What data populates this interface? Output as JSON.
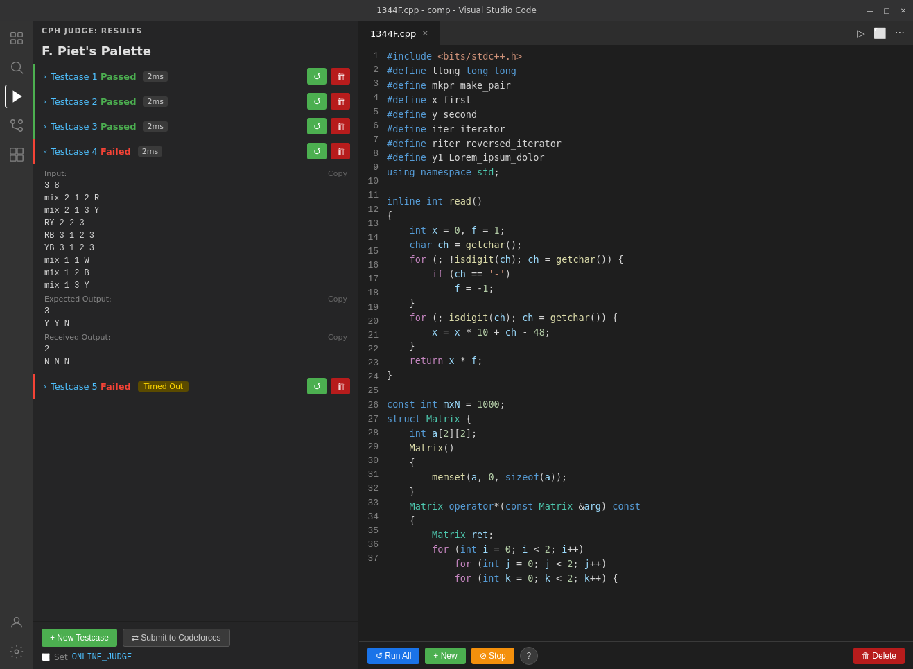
{
  "titlebar": {
    "title": "1344F.cpp - comp - Visual Studio Code",
    "min": "—",
    "max": "□",
    "close": "✕"
  },
  "activity": {
    "icons": [
      "explorer",
      "search",
      "source-control",
      "run",
      "extensions",
      "settings"
    ]
  },
  "cph": {
    "header": "CPH JUDGE: RESULTS",
    "problem_title": "F. Piet's Palette",
    "testcases": [
      {
        "id": 1,
        "status": "Passed",
        "time": "2ms",
        "expanded": false,
        "color": "passed"
      },
      {
        "id": 2,
        "status": "Passed",
        "time": "2ms",
        "expanded": false,
        "color": "passed"
      },
      {
        "id": 3,
        "status": "Passed",
        "time": "2ms",
        "expanded": false,
        "color": "passed"
      },
      {
        "id": 4,
        "status": "Failed",
        "time": "2ms",
        "expanded": true,
        "color": "failed",
        "input": "3 8\nmix 2 1 2 R\nmix 2 1 3 Y\nRY 2 2 3\nRB 3 1 2 3\nYB 3 1 2 3\nmix 1 1 W\nmix 1 2 B\nmix 1 3 Y",
        "expected_output": "3\nY Y N",
        "received_output": "2\nN N N"
      },
      {
        "id": 5,
        "status": "Failed",
        "time_badge": "Timed Out",
        "expanded": false,
        "color": "failed"
      }
    ],
    "new_testcase_label": "+ New Testcase",
    "submit_label": "⇄ Submit to Codeforces",
    "online_judge_label": "ONLINE_JUDGE",
    "set_label": "Set"
  },
  "editor": {
    "tab_name": "1344F.cpp",
    "lines": [
      {
        "n": 1,
        "code": "#include <bits/stdc++.h>"
      },
      {
        "n": 2,
        "code": "#define llong long long"
      },
      {
        "n": 3,
        "code": "#define mkpr make_pair"
      },
      {
        "n": 4,
        "code": "#define x first"
      },
      {
        "n": 5,
        "code": "#define y second"
      },
      {
        "n": 6,
        "code": "#define iter iterator"
      },
      {
        "n": 7,
        "code": "#define riter reversed_iterator"
      },
      {
        "n": 8,
        "code": "#define y1 Lorem_ipsum_dolor"
      },
      {
        "n": 9,
        "code": "using namespace std;"
      },
      {
        "n": 10,
        "code": ""
      },
      {
        "n": 11,
        "code": "inline int read()"
      },
      {
        "n": 12,
        "code": "{"
      },
      {
        "n": 13,
        "code": "    int x = 0, f = 1;"
      },
      {
        "n": 14,
        "code": "    char ch = getchar();"
      },
      {
        "n": 15,
        "code": "    for (; !isdigit(ch); ch = getchar()) {"
      },
      {
        "n": 16,
        "code": "        if (ch == '-')"
      },
      {
        "n": 17,
        "code": "            f = -1;"
      },
      {
        "n": 18,
        "code": "    }"
      },
      {
        "n": 19,
        "code": "    for (; isdigit(ch); ch = getchar()) {"
      },
      {
        "n": 20,
        "code": "        x = x * 10 + ch - 48;"
      },
      {
        "n": 21,
        "code": "    }"
      },
      {
        "n": 22,
        "code": "    return x * f;"
      },
      {
        "n": 23,
        "code": "}"
      },
      {
        "n": 24,
        "code": ""
      },
      {
        "n": 25,
        "code": "const int mxN = 1000;"
      },
      {
        "n": 26,
        "code": "struct Matrix {"
      },
      {
        "n": 27,
        "code": "    int a[2][2];"
      },
      {
        "n": 28,
        "code": "    Matrix()"
      },
      {
        "n": 29,
        "code": "    {"
      },
      {
        "n": 30,
        "code": "        memset(a, 0, sizeof(a));"
      },
      {
        "n": 31,
        "code": "    }"
      },
      {
        "n": 32,
        "code": "    Matrix operator*(const Matrix &arg) const"
      },
      {
        "n": 33,
        "code": "    {"
      },
      {
        "n": 34,
        "code": "        Matrix ret;"
      },
      {
        "n": 35,
        "code": "        for (int i = 0; i < 2; i++)"
      },
      {
        "n": 36,
        "code": "            for (int j = 0; j < 2; j++)"
      },
      {
        "n": 37,
        "code": "            for (int k = 0; k < 2; k++) {"
      }
    ],
    "run_all_label": "↺ Run All",
    "new_label": "+ New",
    "stop_label": "⊘ Stop",
    "help_label": "?",
    "delete_label": "🗑 Delete"
  }
}
